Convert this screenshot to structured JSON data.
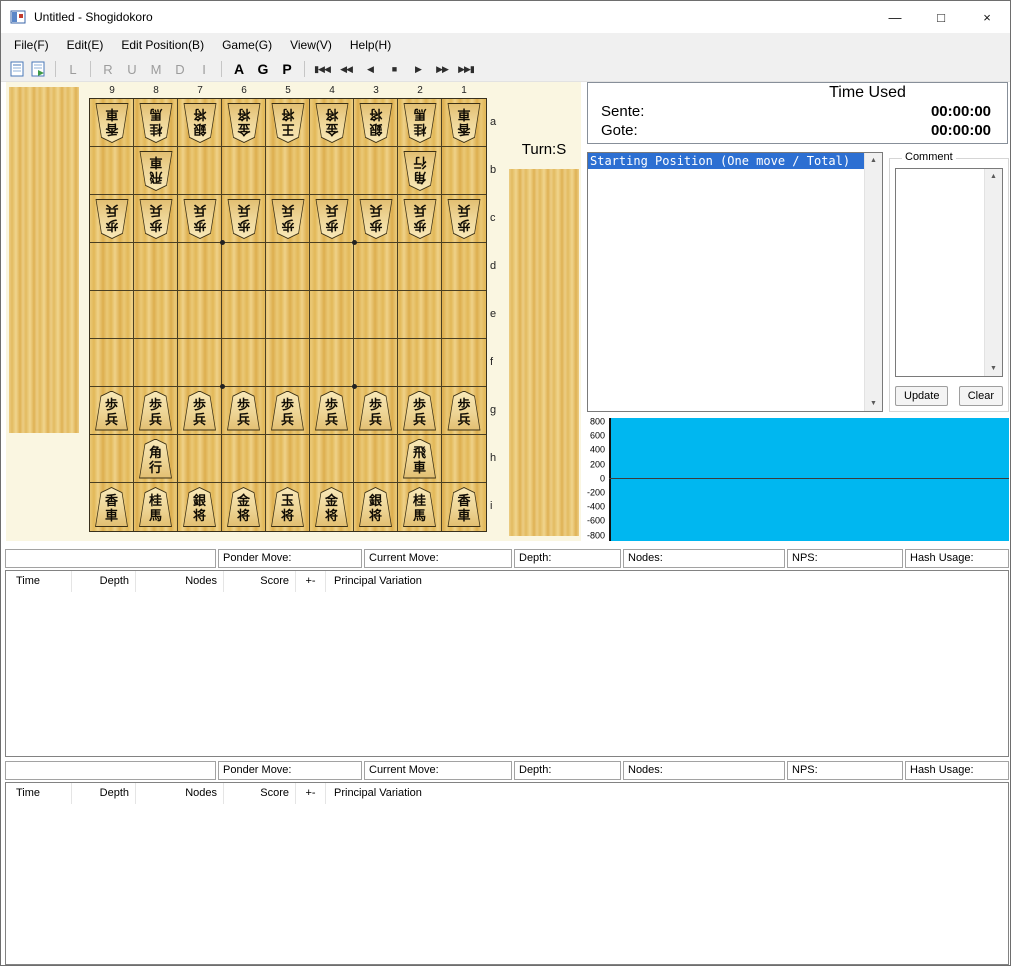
{
  "window": {
    "title": "Untitled - Shogidokoro",
    "minimize_glyph": "—",
    "maximize_glyph": "□",
    "close_glyph": "×"
  },
  "menu": {
    "items": [
      "File(F)",
      "Edit(E)",
      "Edit Position(B)",
      "Game(G)",
      "View(V)",
      "Help(H)"
    ]
  },
  "toolbar": {
    "file_icons": [
      "new-file-icon",
      "open-file-icon"
    ],
    "letter_groups": [
      {
        "labels": [
          "L"
        ],
        "enabled": false
      },
      {
        "labels": [
          "R",
          "U",
          "M",
          "D",
          "I"
        ],
        "enabled": false
      },
      {
        "labels": [
          "A",
          "G",
          "P"
        ],
        "enabled": true
      }
    ],
    "playback": [
      {
        "name": "skip-to-start",
        "glyph": "▮◀◀"
      },
      {
        "name": "fast-rewind",
        "glyph": "◀◀"
      },
      {
        "name": "step-back",
        "glyph": "◀"
      },
      {
        "name": "stop",
        "glyph": "■"
      },
      {
        "name": "step-forward",
        "glyph": "▶"
      },
      {
        "name": "fast-forward",
        "glyph": "▶▶"
      },
      {
        "name": "skip-to-end",
        "glyph": "▶▶▮"
      }
    ]
  },
  "board": {
    "files": [
      "9",
      "8",
      "7",
      "6",
      "5",
      "4",
      "3",
      "2",
      "1"
    ],
    "ranks": [
      "a",
      "b",
      "c",
      "d",
      "e",
      "f",
      "g",
      "h",
      "i"
    ],
    "turn_label": "Turn:S",
    "rows": [
      [
        {
          "k": "香車",
          "s": "gote"
        },
        {
          "k": "桂馬",
          "s": "gote"
        },
        {
          "k": "銀将",
          "s": "gote"
        },
        {
          "k": "金将",
          "s": "gote"
        },
        {
          "k": "王将",
          "s": "gote"
        },
        {
          "k": "金将",
          "s": "gote"
        },
        {
          "k": "銀将",
          "s": "gote"
        },
        {
          "k": "桂馬",
          "s": "gote"
        },
        {
          "k": "香車",
          "s": "gote"
        }
      ],
      [
        null,
        {
          "k": "飛車",
          "s": "gote"
        },
        null,
        null,
        null,
        null,
        null,
        {
          "k": "角行",
          "s": "gote"
        },
        null
      ],
      [
        {
          "k": "歩兵",
          "s": "gote"
        },
        {
          "k": "歩兵",
          "s": "gote"
        },
        {
          "k": "歩兵",
          "s": "gote"
        },
        {
          "k": "歩兵",
          "s": "gote"
        },
        {
          "k": "歩兵",
          "s": "gote"
        },
        {
          "k": "歩兵",
          "s": "gote"
        },
        {
          "k": "歩兵",
          "s": "gote"
        },
        {
          "k": "歩兵",
          "s": "gote"
        },
        {
          "k": "歩兵",
          "s": "gote"
        }
      ],
      [
        null,
        null,
        null,
        null,
        null,
        null,
        null,
        null,
        null
      ],
      [
        null,
        null,
        null,
        null,
        null,
        null,
        null,
        null,
        null
      ],
      [
        null,
        null,
        null,
        null,
        null,
        null,
        null,
        null,
        null
      ],
      [
        {
          "k": "歩兵",
          "s": "sente"
        },
        {
          "k": "歩兵",
          "s": "sente"
        },
        {
          "k": "歩兵",
          "s": "sente"
        },
        {
          "k": "歩兵",
          "s": "sente"
        },
        {
          "k": "歩兵",
          "s": "sente"
        },
        {
          "k": "歩兵",
          "s": "sente"
        },
        {
          "k": "歩兵",
          "s": "sente"
        },
        {
          "k": "歩兵",
          "s": "sente"
        },
        {
          "k": "歩兵",
          "s": "sente"
        }
      ],
      [
        null,
        {
          "k": "角行",
          "s": "sente"
        },
        null,
        null,
        null,
        null,
        null,
        {
          "k": "飛車",
          "s": "sente"
        },
        null
      ],
      [
        {
          "k": "香車",
          "s": "sente"
        },
        {
          "k": "桂馬",
          "s": "sente"
        },
        {
          "k": "銀将",
          "s": "sente"
        },
        {
          "k": "金将",
          "s": "sente"
        },
        {
          "k": "玉将",
          "s": "sente"
        },
        {
          "k": "金将",
          "s": "sente"
        },
        {
          "k": "銀将",
          "s": "sente"
        },
        {
          "k": "桂馬",
          "s": "sente"
        },
        {
          "k": "香車",
          "s": "sente"
        }
      ]
    ]
  },
  "time_panel": {
    "title": "Time Used",
    "sente_label": "Sente:",
    "gote_label": "Gote:",
    "sente_time": "00:00:00",
    "gote_time": "00:00:00"
  },
  "move_list": {
    "items": [
      {
        "text": "Starting Position (One move / Total)",
        "selected": true
      }
    ]
  },
  "comment_panel": {
    "title": "Comment",
    "text": "",
    "update_label": "Update",
    "clear_label": "Clear"
  },
  "eval_graph": {
    "y_ticks": [
      "800",
      "600",
      "400",
      "200",
      "0",
      "-200",
      "-400",
      "-600",
      "-800"
    ]
  },
  "engine_panels": [
    {
      "info_labels": [
        "",
        "Ponder Move:",
        "Current Move:",
        "Depth:",
        "Nodes:",
        "NPS:",
        "Hash Usage:"
      ],
      "columns": [
        {
          "label": "Time"
        },
        {
          "label": "Depth"
        },
        {
          "label": "Nodes"
        },
        {
          "label": "Score"
        },
        {
          "label": "+-"
        },
        {
          "label": "Principal Variation"
        }
      ],
      "rows": []
    },
    {
      "info_labels": [
        "",
        "Ponder Move:",
        "Current Move:",
        "Depth:",
        "Nodes:",
        "NPS:",
        "Hash Usage:"
      ],
      "columns": [
        {
          "label": "Time"
        },
        {
          "label": "Depth"
        },
        {
          "label": "Nodes"
        },
        {
          "label": "Score"
        },
        {
          "label": "+-"
        },
        {
          "label": "Principal Variation"
        }
      ],
      "rows": []
    }
  ],
  "colors": {
    "selection_blue": "#2c6fd2",
    "graph_cyan": "#00b7f0",
    "board_wood": "#e7c370",
    "panel_cream": "#faf6e1"
  }
}
